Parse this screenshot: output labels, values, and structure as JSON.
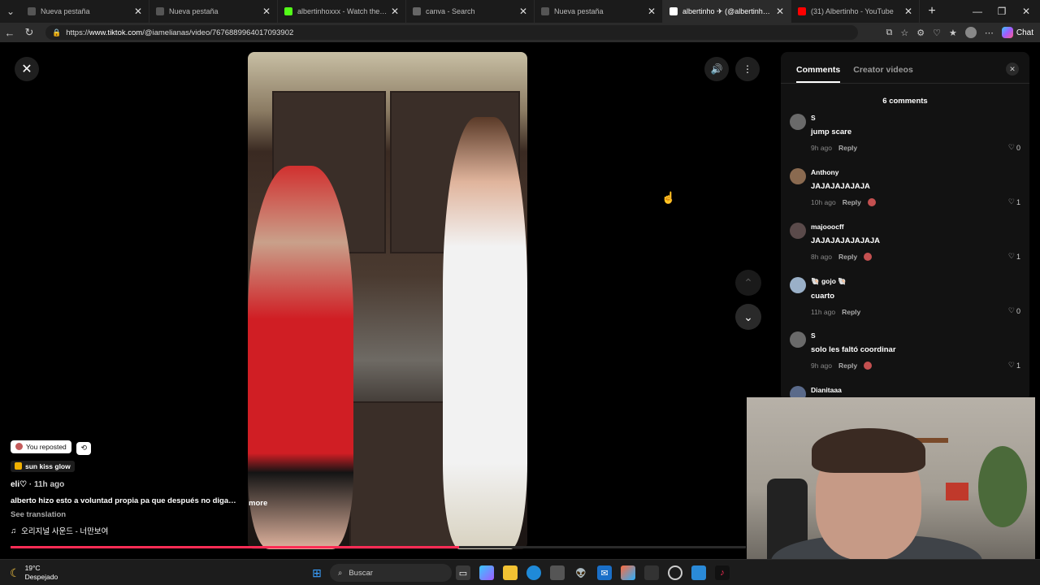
{
  "browser": {
    "tabs": [
      {
        "title": "Nueva pestaña",
        "fav": "#555555",
        "active": false
      },
      {
        "title": "Nueva pestaña",
        "fav": "#555555",
        "active": false
      },
      {
        "title": "albertinhoxxx - Watch the VOD on Kick",
        "fav": "#53fc18",
        "active": false
      },
      {
        "title": "canva - Search",
        "fav": "#666666",
        "active": false
      },
      {
        "title": "Nueva pestaña",
        "fav": "#555555",
        "active": false
      },
      {
        "title": "albertinho ✈ (@albertinhoxxx)",
        "fav": "#ffffff",
        "active": true
      },
      {
        "title": "(31) Albertinho - YouTube",
        "fav": "#ff0000",
        "active": false
      }
    ],
    "url_prefix": "https://",
    "url_host": "www.tiktok.com",
    "url_path": "/@iamelianas/video/7676889964017093902",
    "chat_label": "Chat"
  },
  "video": {
    "reposted_label": "You reposted",
    "tag_label": "sun kiss glow",
    "author": "eli♡",
    "time_ago": " · 11h ago",
    "caption": "alberto hizo esto a voluntad propia pa que después no digan ...",
    "more_label": "more",
    "translation_label": "See translation",
    "sound_icon": "♫",
    "sound": "오리지널 사운드 - 너만보여",
    "progress": 0.61
  },
  "comments_panel": {
    "tab_comments": "Comments",
    "tab_creator": "Creator videos",
    "count_label": "6 comments",
    "reply_label": "Reply",
    "comments": [
      {
        "user": "S",
        "text": "jump scare",
        "time": "9h ago",
        "likes": "0",
        "avatar": "#6a6a6a",
        "reacted": false
      },
      {
        "user": "Anthony",
        "text": "JAJAJAJAJAJA",
        "time": "10h ago",
        "likes": "1",
        "avatar": "#8a6a50",
        "reacted": true
      },
      {
        "user": "majooocff",
        "text": "JAJAJAJAJAJAJA",
        "time": "8h ago",
        "likes": "1",
        "avatar": "#5a4a4a",
        "reacted": true
      },
      {
        "user": "🐚 gojo 🐚",
        "text": "cuarto",
        "time": "11h ago",
        "likes": "0",
        "avatar": "#9ab0c8",
        "reacted": false
      },
      {
        "user": "S",
        "text": "solo les faltó coordinar",
        "time": "9h ago",
        "likes": "1",
        "avatar": "#6a6a6a",
        "reacted": true
      },
      {
        "user": "Dianitaaa",
        "text": "",
        "time": "",
        "likes": "",
        "avatar": "#5a6a8a",
        "reacted": false
      }
    ]
  },
  "taskbar": {
    "temperature": "19°C",
    "weather": "Despejado",
    "search_placeholder": "Buscar"
  }
}
